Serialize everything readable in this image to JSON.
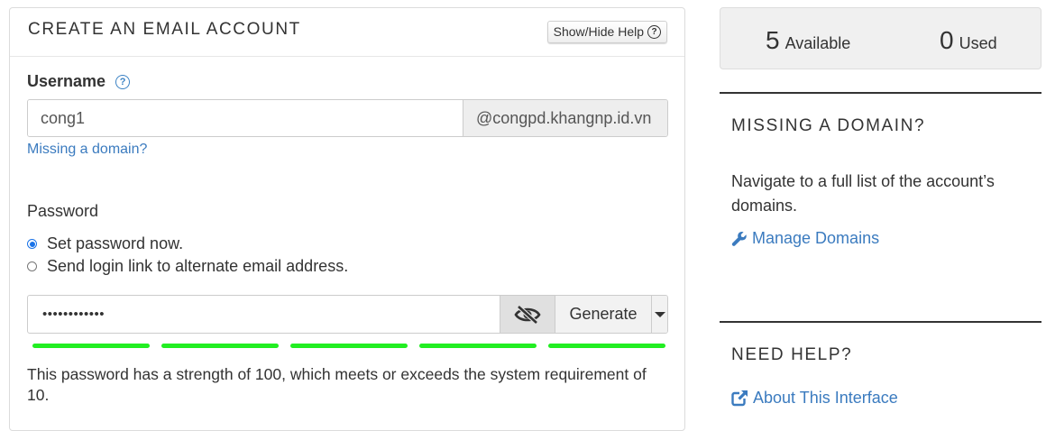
{
  "form": {
    "title": "CREATE AN EMAIL ACCOUNT",
    "help_button": "Show/Hide Help",
    "username_label": "Username",
    "username_value": "cong1",
    "domain_suffix": "@congpd.khangnp.id.vn",
    "missing_domain_link": "Missing a domain?",
    "password_label": "Password",
    "radio_options": [
      {
        "label": "Set password now.",
        "selected": true
      },
      {
        "label": "Send login link to alternate email address.",
        "selected": false
      }
    ],
    "password_masked": "••••••••••••",
    "generate_label": "Generate",
    "strength_bars_filled": 5,
    "strength_bar_color": "#22ee22",
    "strength_text": "This password has a strength of 100, which meets or exceeds the system requirement of 10."
  },
  "sidebar": {
    "available_count": "5",
    "available_label": "Available",
    "used_count": "0",
    "used_label": "Used",
    "missing_domain_title": "MISSING A DOMAIN?",
    "missing_domain_text": "Navigate to a full list of the account’s domains.",
    "manage_domains_link": "Manage Domains",
    "need_help_title": "NEED HELP?",
    "about_link": "About This Interface"
  },
  "colors": {
    "link": "#3b7bbf",
    "radio_selected": "#1a73e8"
  },
  "icons": {
    "help": "question-circle-icon",
    "eye": "eye-slash-icon",
    "caret": "caret-down-icon",
    "wrench": "wrench-icon",
    "external": "external-link-icon"
  }
}
